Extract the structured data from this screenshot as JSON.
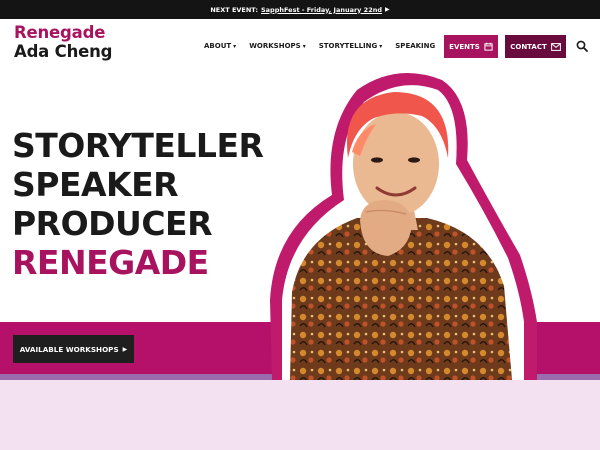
{
  "announcement": {
    "prefix": "NEXT EVENT:",
    "link_text": "SapphFest - Friday, January 22nd",
    "arrow": "▶"
  },
  "logo": {
    "line1": "Renegade",
    "line2": "Ada Cheng"
  },
  "nav": {
    "items": [
      {
        "label": "ABOUT",
        "has_dropdown": true
      },
      {
        "label": "WORKSHOPS",
        "has_dropdown": true
      },
      {
        "label": "STORYTELLING",
        "has_dropdown": true
      },
      {
        "label": "SPEAKING",
        "has_dropdown": false
      }
    ],
    "caret": "▾",
    "events_label": "EVENTS",
    "contact_label": "CONTACT"
  },
  "hero": {
    "lines": [
      "STORYTELLER",
      "SPEAKER",
      "PRODUCER",
      "RENEGADE"
    ],
    "cta_label": "AVAILABLE WORKSHOPS",
    "cta_arrow": "▶"
  },
  "colors": {
    "brand": "#a8135f",
    "brand_dark": "#6a0b3e",
    "band": "#b5116a",
    "band_line": "#9a6cae",
    "lower_bg": "#f3e0f1",
    "text": "#1a1a1a"
  },
  "icons": {
    "events": "calendar-icon",
    "contact": "envelope-icon",
    "search": "search-icon"
  }
}
